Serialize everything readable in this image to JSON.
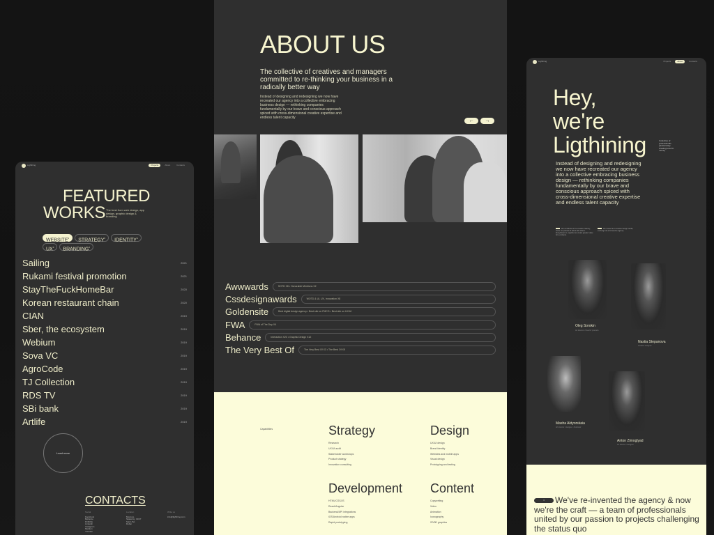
{
  "left_panel": {
    "nav": {
      "logo": "Lighthing",
      "links": [
        "Projects",
        "About",
        "Contacts"
      ],
      "active_index": 0
    },
    "title_line1": "FEATURED",
    "title_line2": "WORKS",
    "subtitle": "The best from web design, app design, graphic design & branding",
    "filters": [
      {
        "label": "WEBSITE",
        "count": "9",
        "active": true
      },
      {
        "label": "STRATEGY",
        "count": "6",
        "active": false
      },
      {
        "label": "IDENTITY",
        "count": "4",
        "active": false
      },
      {
        "label": "UX",
        "count": "3",
        "active": false
      },
      {
        "label": "BRANDING",
        "count": "5",
        "active": false
      }
    ],
    "works": [
      {
        "name": "Sailing",
        "year": "2021"
      },
      {
        "name": "Rukami festival promotion",
        "year": "2021"
      },
      {
        "name": "StayTheFuckHomeBar",
        "year": "2020"
      },
      {
        "name": "Korean restaurant chain",
        "year": "2020"
      },
      {
        "name": "CIAN",
        "year": "2019"
      },
      {
        "name": "Sber, the ecosystem",
        "year": "2019"
      },
      {
        "name": "Webium",
        "year": "2019"
      },
      {
        "name": "Sova VC",
        "year": "2019"
      },
      {
        "name": "AgroCode",
        "year": "2019"
      },
      {
        "name": "TJ Collection",
        "year": "2019"
      },
      {
        "name": "RDS TV",
        "year": "2019"
      },
      {
        "name": "SBi bank",
        "year": "2019"
      },
      {
        "name": "Artlife",
        "year": "2019"
      }
    ],
    "load_more": "Load more",
    "contacts_title": "CONTACTS",
    "contacts": {
      "social_label": "Social",
      "social": [
        "Facebook",
        "Behance",
        "Dribbble",
        "Linkedin",
        "Instagram",
        "Medium",
        "Youtube"
      ],
      "location_label": "Location",
      "location": [
        "Moscow,",
        "Skaterniy, 13/27",
        "Saint-Pet.",
        "Dubai"
      ],
      "write_label": "Write us",
      "email": "info@lighthing.com"
    }
  },
  "middle_panel": {
    "title": "ABOUT US",
    "lead": "The collective of creatives and managers committed to re-thinking your business in a radically better way",
    "body": "Instead of designing and redesigning we now have recreated our agency into a collective embracing business design — rethinking companies fundamentally by our brave and conscious approach spiced with cross-dimensional creative expertise and endless talent capacity",
    "prev_arrow": "←",
    "next_arrow": "→",
    "awards": [
      {
        "name": "Awwwards",
        "details": "SOTD X8   •   Honorable Mentions X2"
      },
      {
        "name": "Cssdesignawards",
        "details": "WOTD & UI, UX, Innovation X8"
      },
      {
        "name": "Goldensite",
        "details": "Best digital design agency   •   Best site on FMCG   •   Best site on UX/UI"
      },
      {
        "name": "FWA",
        "details": "FWA of The Day X4"
      },
      {
        "name": "Behance",
        "details": "Interaction X23   •   Graphic Design X12"
      },
      {
        "name": "The Very Best Of",
        "details": "The Very Best Of X3   •   The Best Of X5"
      }
    ],
    "capabilities_label": "Capabilities",
    "capabilities": [
      {
        "title": "Strategy",
        "items": [
          "Research",
          "UX/UI audit",
          "Stakeholder workshops",
          "Product strategy",
          "Innovation consulting"
        ]
      },
      {
        "title": "Design",
        "items": [
          "UX/UI design",
          "Brand identity",
          "Websites and mobile apps",
          "Visual design",
          "Prototyping and testing"
        ]
      },
      {
        "title": "Development",
        "items": [
          "HTML/CSS/JS",
          "React/Angular",
          "Backend/API integrations",
          "iOS/Android native apps",
          "Rapid prototyping"
        ]
      },
      {
        "title": "Content",
        "items": [
          "Copywriting",
          "Video",
          "Animation",
          "Iconography",
          "2D/3D graphics"
        ]
      }
    ]
  },
  "right_panel": {
    "nav": {
      "logo": "Lighthing",
      "links": [
        "Projects",
        "About",
        "Contacts"
      ],
      "active_index": 1
    },
    "hero_line1": "Hey,",
    "hero_line2": "we're",
    "hero_line3": "Ligthining",
    "hero_side": "Collective of professionals passionately creating love for money",
    "body": "Instead of designing and redesigning we now have recreated our agency into a collective embracing business design — rethinking companies fundamentally by our brave and conscious approach spiced with cross-dimensional creative expertise and endless talent capacity",
    "note1": "We contribute to the creative industry, share our passion & talent with others. Everybody's in, together we create greater value for our clients.",
    "note2": "We started as a creative design studio, evolving into a full-service agency.",
    "team": [
      {
        "name": "Oleg Sorokin",
        "role": "Art director   •   Head of products"
      },
      {
        "name": "Nastia Stepanova",
        "role": "Creative designer"
      },
      {
        "name": "Masha Aktyorskaia",
        "role": "Art director / designer   •   Illustrator"
      },
      {
        "name": "Anton Zimoglyad",
        "role": "Art director / designer"
      }
    ],
    "badge": "3",
    "statement": "We've re-invented the agency & now we're the craft — a team of professionals united by our passion to projects challenging the status quo"
  }
}
